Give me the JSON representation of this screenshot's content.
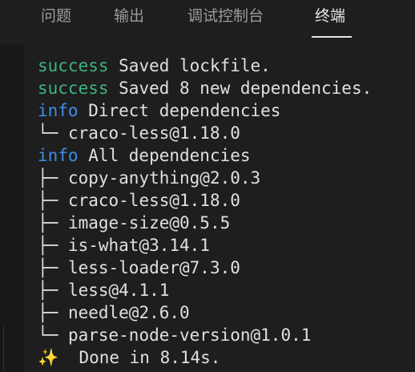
{
  "tabs": [
    {
      "label": "问题",
      "active": false
    },
    {
      "label": "输出",
      "active": false
    },
    {
      "label": "调试控制台",
      "active": false
    },
    {
      "label": "终端",
      "active": true
    }
  ],
  "terminal": {
    "lines": [
      {
        "prefix": "success",
        "text": " Saved lockfile."
      },
      {
        "prefix": "success",
        "text": " Saved 8 new dependencies."
      },
      {
        "prefix": "info",
        "text": " Direct dependencies"
      },
      {
        "tree": "└─",
        "text": " craco-less@1.18.0"
      },
      {
        "prefix": "info",
        "text": " All dependencies"
      },
      {
        "tree": "├─",
        "text": " copy-anything@2.0.3"
      },
      {
        "tree": "├─",
        "text": " craco-less@1.18.0"
      },
      {
        "tree": "├─",
        "text": " image-size@0.5.5"
      },
      {
        "tree": "├─",
        "text": " is-what@3.14.1"
      },
      {
        "tree": "├─",
        "text": " less-loader@7.3.0"
      },
      {
        "tree": "├─",
        "text": " less@4.1.1"
      },
      {
        "tree": "├─",
        "text": " needle@2.6.0"
      },
      {
        "tree": "└─",
        "text": " parse-node-version@1.0.1"
      },
      {
        "sparkle": "✨",
        "text": "  Done in 8.14s."
      }
    ]
  },
  "colors": {
    "background": "#1e1e1e",
    "success": "#3fb37f",
    "info": "#3b8eea",
    "text": "#e0e0e0"
  }
}
